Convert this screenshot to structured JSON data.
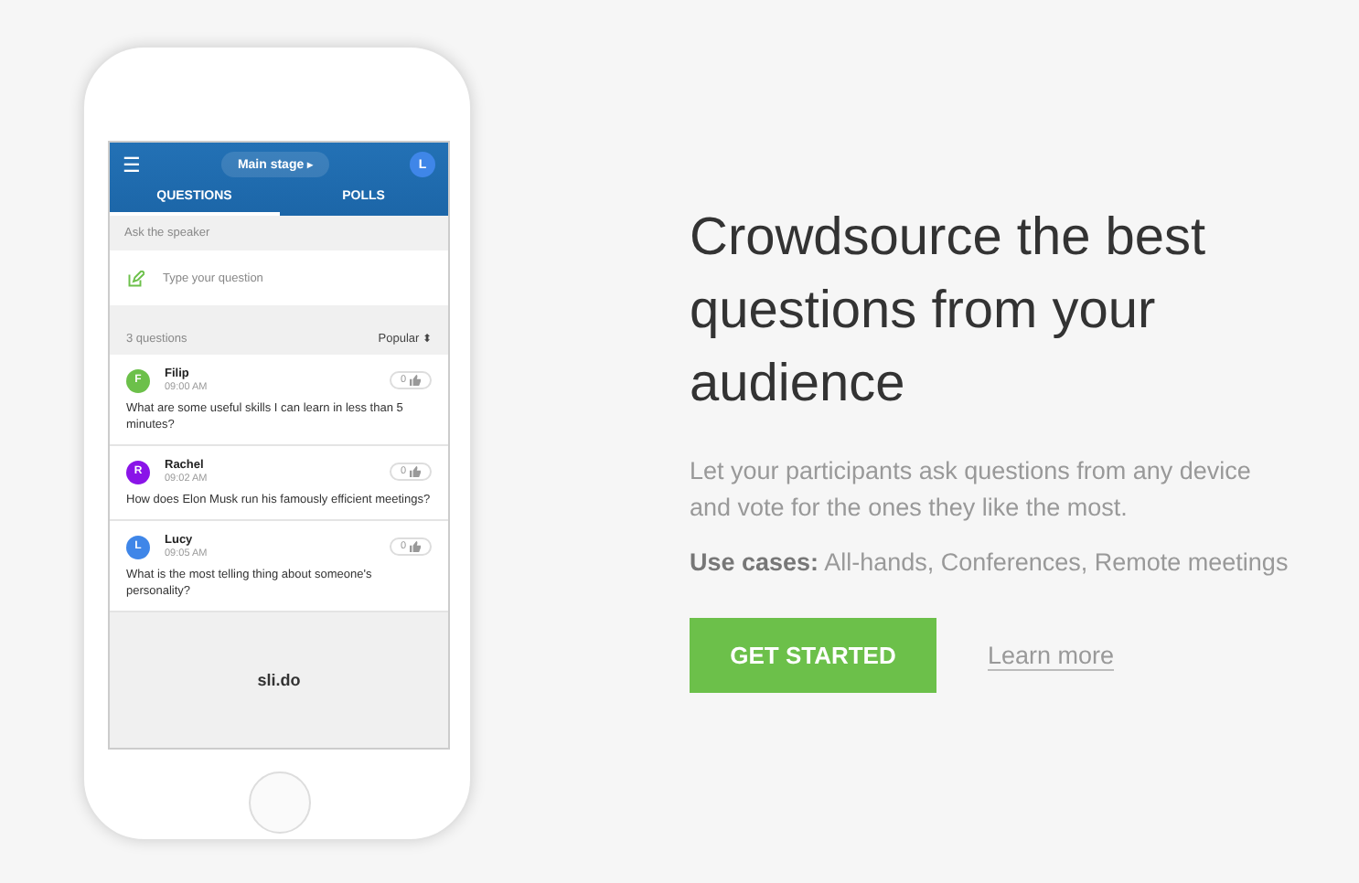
{
  "app": {
    "menu": "☰",
    "event": "Main stage",
    "event_caret": "▸",
    "user_initial": "L",
    "tabs": [
      {
        "label": "QUESTIONS",
        "selected": true
      },
      {
        "label": "POLLS",
        "selected": false
      }
    ],
    "ask_label": "Ask the speaker",
    "input": {
      "placeholder": "Type your question"
    },
    "count": "3 questions",
    "sort": "Popular",
    "sort_caret": "⬍",
    "questions": [
      {
        "initial": "F",
        "color": "#6cc04a",
        "name": "Filip",
        "time": "09:00 AM",
        "votes": "0",
        "text": "What are some useful skills I can learn in less than 5 minutes?"
      },
      {
        "initial": "R",
        "color": "#8a14e8",
        "name": "Rachel",
        "time": "09:02 AM",
        "votes": "0",
        "text": "How does Elon Musk run his famously efficient meetings?"
      },
      {
        "initial": "L",
        "color": "#3f86e8",
        "name": "Lucy",
        "time": "09:05 AM",
        "votes": "0",
        "text": "What is the most telling thing about someone's personality?"
      }
    ],
    "logo": "sli.do"
  },
  "hero": {
    "heading": "Crowdsource the best questions from your audience",
    "description": "Let your participants ask questions from any device and vote for the ones they like the most.",
    "use_cases": "**Use cases:** All-hands, Conferences, Remote meetings",
    "cta": "GET STARTED",
    "link": "Learn more"
  }
}
